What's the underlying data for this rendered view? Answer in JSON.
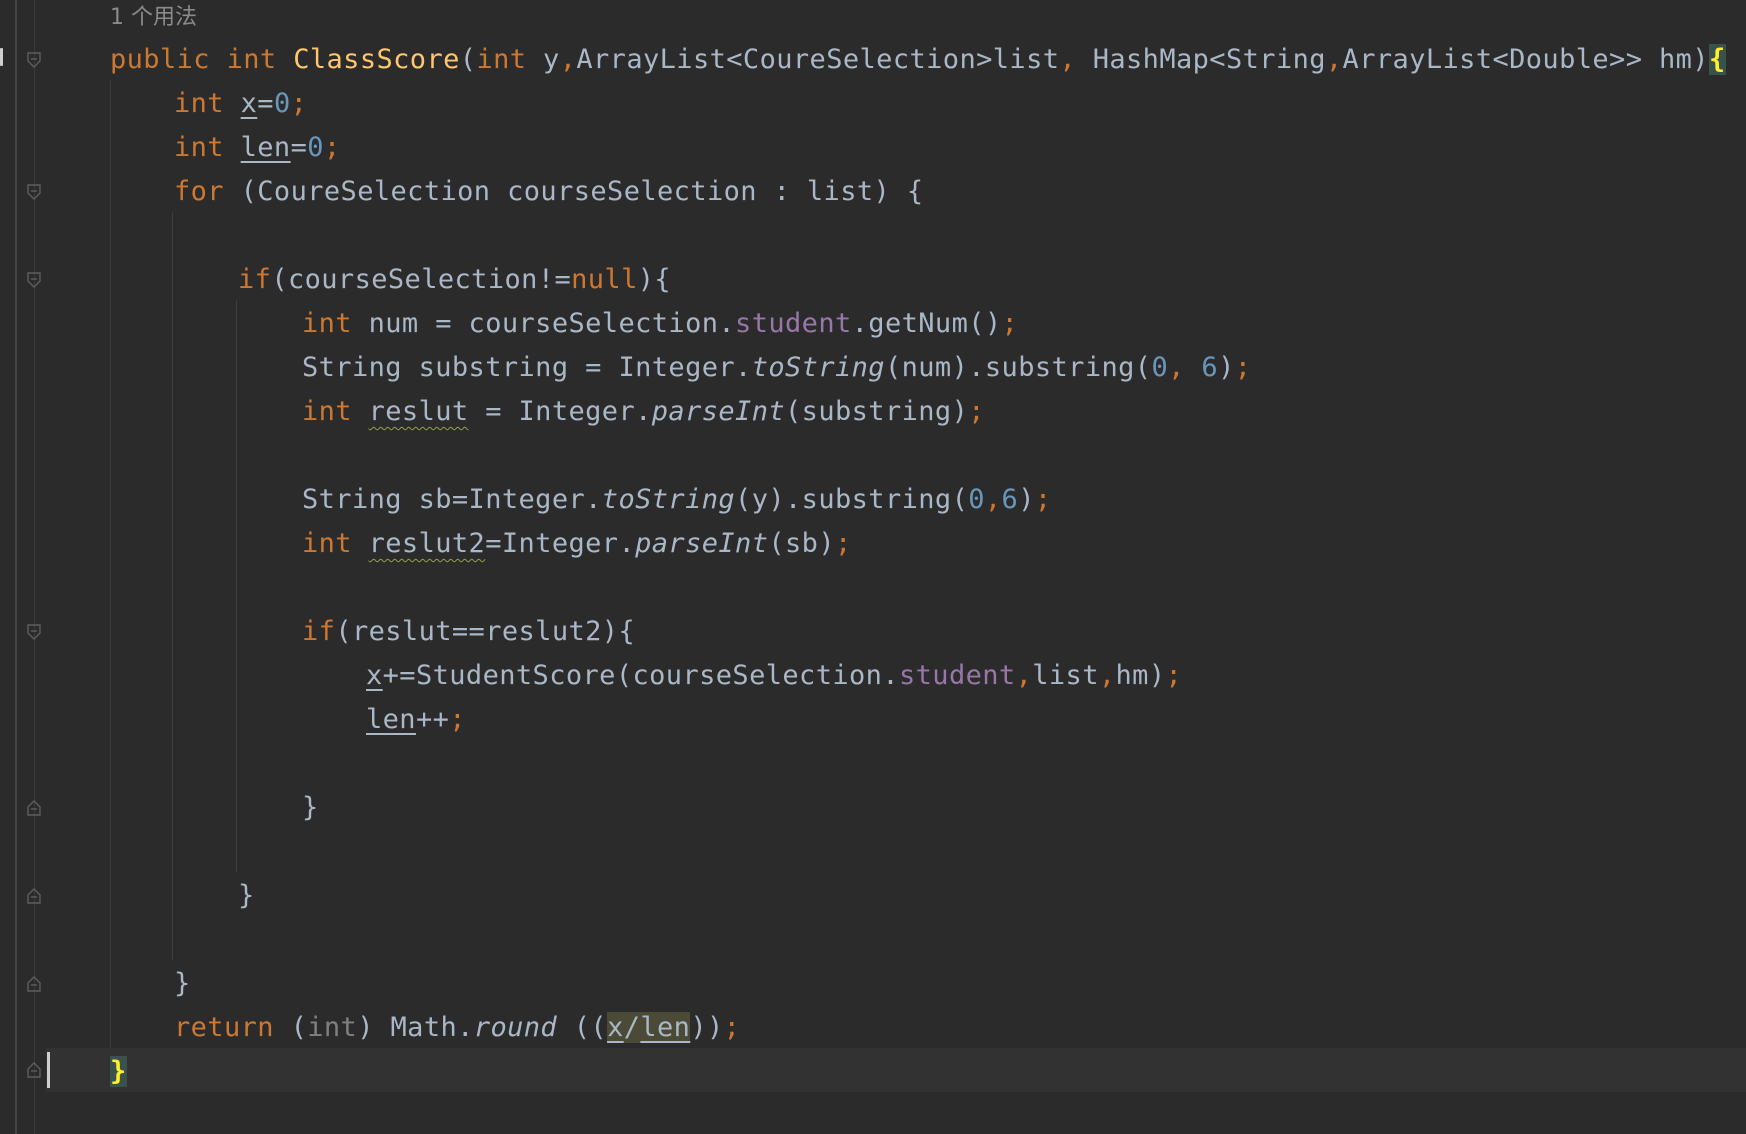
{
  "editor": {
    "usage_hint": "1 个用法",
    "lines": {
      "l1": {
        "t1": "public",
        "t2": " ",
        "t3": "int",
        "t4": " ",
        "t5": "ClassScore",
        "t6": "(",
        "t7": "int",
        "t8": " y",
        "t9": ",",
        "t10": "ArrayList<CoureSelection>list",
        "t11": ",",
        "t12": " HashMap<String",
        "t13": ",",
        "t14": "ArrayList<Double>> hm)",
        "t15": "{"
      },
      "l2": {
        "t1": "int",
        "t2": " ",
        "t3": "x",
        "t4": "=",
        "t5": "0",
        "t6": ";"
      },
      "l3": {
        "t1": "int",
        "t2": " ",
        "t3": "len",
        "t4": "=",
        "t5": "0",
        "t6": ";"
      },
      "l4": {
        "t1": "for",
        "t2": " (CoureSelection courseSelection : list) {"
      },
      "l6": {
        "t1": "if",
        "t2": "(courseSelection!=",
        "t3": "null",
        "t4": "){"
      },
      "l7": {
        "t1": "int",
        "t2": " num = courseSelection.",
        "t3": "student",
        "t4": ".getNum()",
        "t5": ";"
      },
      "l8": {
        "t1": "String substring = Integer.",
        "t2": "toString",
        "t3": "(num).substring(",
        "t4": "0",
        "t5": ",",
        "t6": " ",
        "t7": "6",
        "t8": ")",
        "t9": ";"
      },
      "l9": {
        "t1": "int",
        "t2": " ",
        "t3": "reslut",
        "t4": " = Integer.",
        "t5": "parseInt",
        "t6": "(substring)",
        "t7": ";"
      },
      "l11": {
        "t1": "String sb=Integer.",
        "t2": "toString",
        "t3": "(y).substring(",
        "t4": "0",
        "t5": ",",
        "t6": "6",
        "t7": ")",
        "t8": ";"
      },
      "l12": {
        "t1": "int",
        "t2": " ",
        "t3": "reslut2",
        "t4": "=Integer.",
        "t5": "parseInt",
        "t6": "(sb)",
        "t7": ";"
      },
      "l14": {
        "t1": "if",
        "t2": "(reslut==reslut2){"
      },
      "l15": {
        "t1": "x",
        "t2": "+=StudentScore(courseSelection.",
        "t3": "student",
        "t4": ",",
        "t5": "list",
        "t6": ",",
        "t7": "hm)",
        "t8": ";"
      },
      "l16": {
        "t1": "len",
        "t2": "++",
        "t3": ";"
      },
      "l18": {
        "t1": "}"
      },
      "l20": {
        "t1": "}"
      },
      "l22": {
        "t1": "}"
      },
      "l23": {
        "t1": "return",
        "t2": " (",
        "t3": "int",
        "t4": ") Math.",
        "t5": "round",
        "t6": " ((",
        "t7": "x",
        "t8": "/",
        "t9": "len",
        "t10": "))",
        "t11": ";"
      },
      "l24": {
        "t1": "}"
      }
    }
  },
  "colors": {
    "background": "#2b2b2b",
    "keyword": "#cc7832",
    "method_decl": "#ffc66d",
    "number": "#6897bb",
    "field": "#9876aa",
    "default_text": "#a9b7c6"
  }
}
